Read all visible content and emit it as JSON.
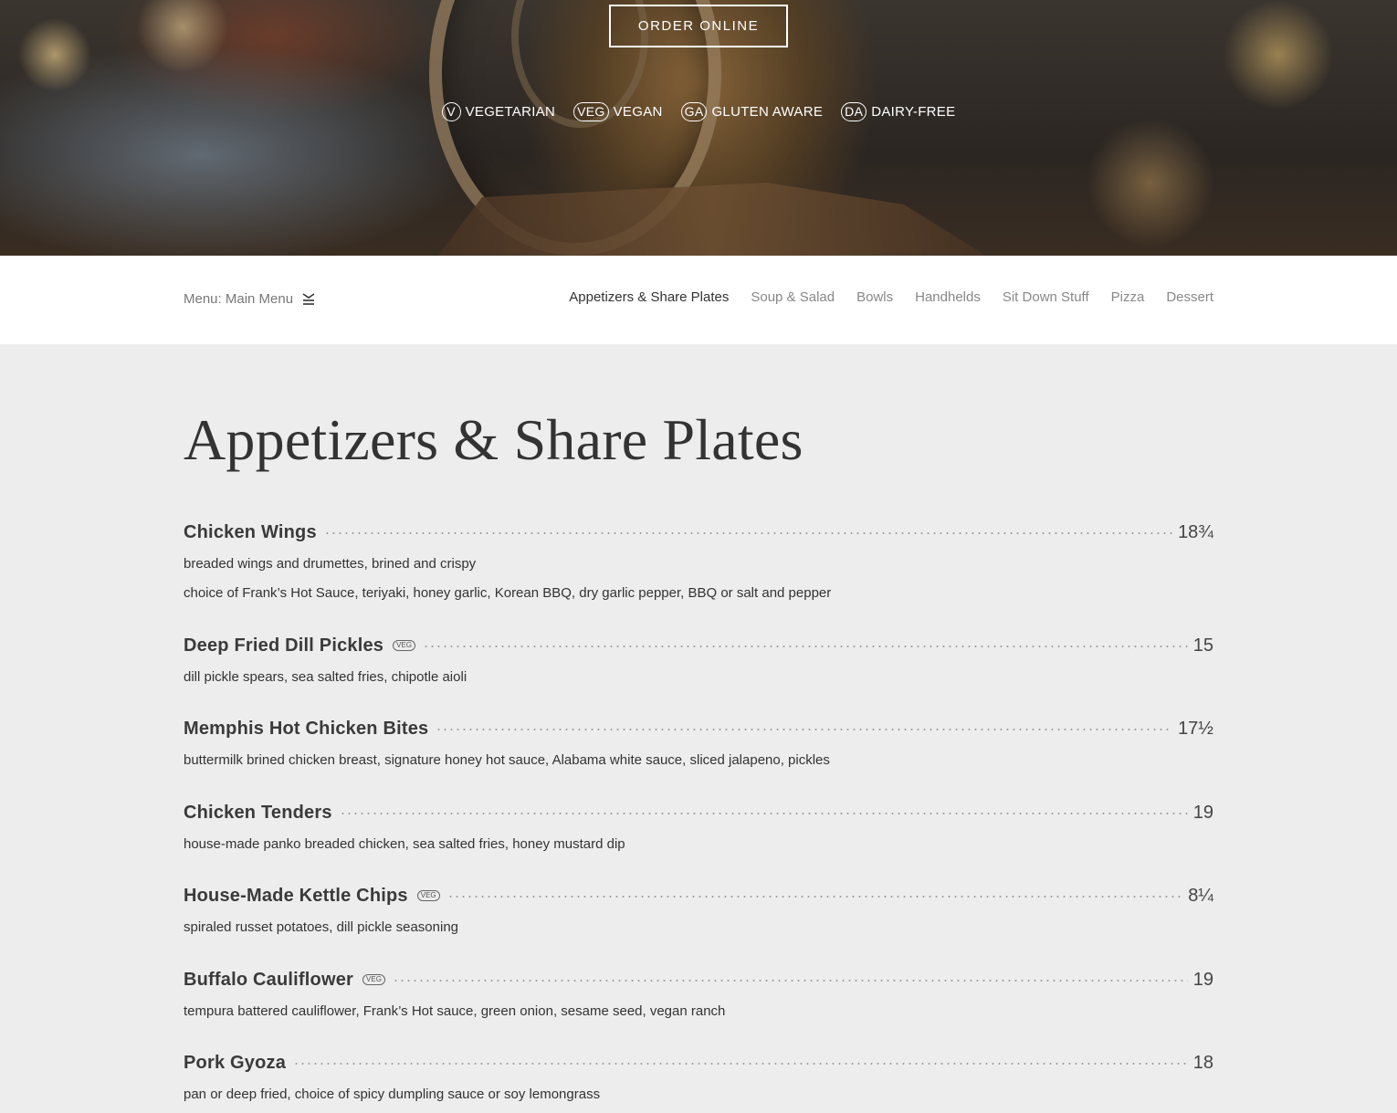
{
  "hero": {
    "order_button": "ORDER ONLINE",
    "legend": [
      {
        "badge": "V",
        "label": "VEGETARIAN"
      },
      {
        "badge": "VEG",
        "label": "VEGAN"
      },
      {
        "badge": "GA",
        "label": "GLUTEN AWARE"
      },
      {
        "badge": "DA",
        "label": "DAIRY-FREE"
      }
    ]
  },
  "nav": {
    "menu_label": "Menu: Main Menu",
    "tabs": [
      {
        "label": "Appetizers & Share Plates",
        "active": true
      },
      {
        "label": "Soup & Salad",
        "active": false
      },
      {
        "label": "Bowls",
        "active": false
      },
      {
        "label": "Handhelds",
        "active": false
      },
      {
        "label": "Sit Down Stuff",
        "active": false
      },
      {
        "label": "Pizza",
        "active": false
      },
      {
        "label": "Dessert",
        "active": false
      }
    ]
  },
  "section": {
    "title": "Appetizers & Share Plates",
    "items": [
      {
        "name": "Chicken Wings",
        "badge": "",
        "price": "18¾",
        "descriptions": [
          "breaded wings and drumettes, brined and crispy",
          "choice of Frank’s Hot Sauce, teriyaki, honey garlic, Korean BBQ, dry garlic pepper, BBQ or salt and pepper"
        ]
      },
      {
        "name": "Deep Fried Dill Pickles",
        "badge": "VEG",
        "price": "15",
        "descriptions": [
          "dill pickle spears, sea salted fries, chipotle aioli"
        ]
      },
      {
        "name": "Memphis Hot Chicken Bites",
        "badge": "",
        "price": "17½",
        "descriptions": [
          "buttermilk brined chicken breast, signature honey hot sauce, Alabama white sauce, sliced jalapeno, pickles"
        ]
      },
      {
        "name": "Chicken Tenders",
        "badge": "",
        "price": "19",
        "descriptions": [
          "house-made panko breaded chicken, sea salted fries, honey mustard dip"
        ]
      },
      {
        "name": "House-Made Kettle Chips",
        "badge": "VEG",
        "price": "8¼",
        "descriptions": [
          "spiraled russet potatoes, dill pickle seasoning"
        ]
      },
      {
        "name": "Buffalo Cauliflower",
        "badge": "VEG",
        "price": "19",
        "descriptions": [
          "tempura battered cauliflower, Frank’s Hot sauce, green onion, sesame seed, vegan ranch"
        ]
      },
      {
        "name": "Pork Gyoza",
        "badge": "",
        "price": "18",
        "descriptions": [
          "pan or deep fried, choice of spicy dumpling sauce or soy lemongrass"
        ]
      }
    ]
  }
}
